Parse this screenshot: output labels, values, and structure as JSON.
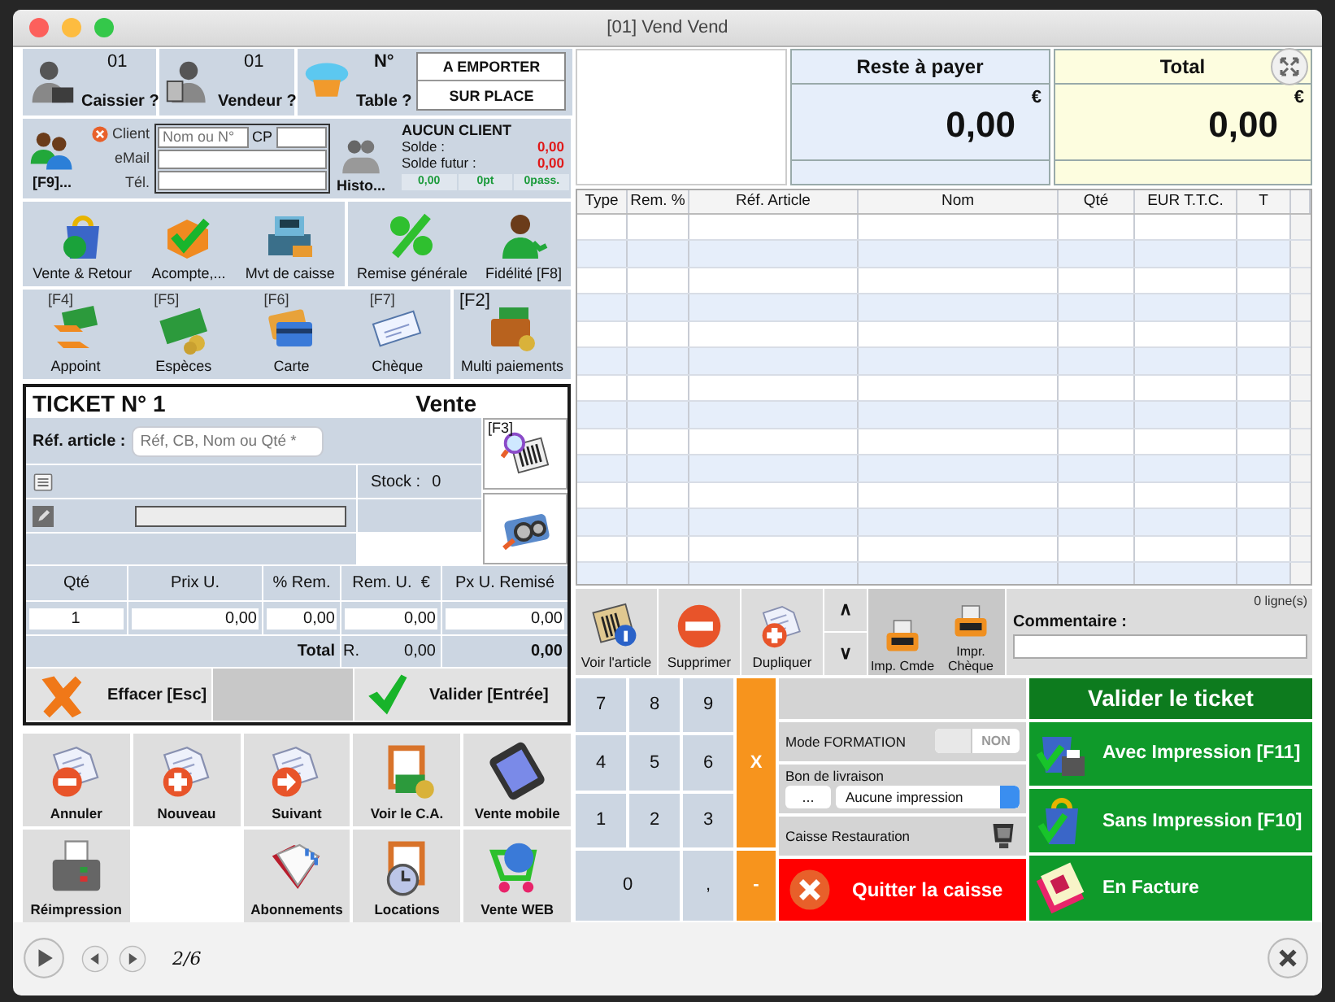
{
  "window": {
    "title": "[01] Vend Vend"
  },
  "header": {
    "cashier": {
      "number": "01",
      "label": "Caissier ?"
    },
    "seller": {
      "number": "01",
      "label": "Vendeur ?"
    },
    "table": {
      "number": "N°",
      "label": "Table ?"
    },
    "service_modes": [
      {
        "label": "A EMPORTER"
      },
      {
        "label": "SUR PLACE"
      }
    ]
  },
  "client": {
    "shortcut": "[F9]...",
    "labels": [
      "Client",
      "eMail",
      "Tél."
    ],
    "name_placeholder": "Nom ou N°",
    "cp_label": "CP",
    "history": "Histo...",
    "status": "AUCUN CLIENT",
    "balances": [
      {
        "label": "Solde :",
        "value": "0,00"
      },
      {
        "label": "Solde futur :",
        "value": "0,00"
      }
    ],
    "counters": [
      "0,00",
      "0pt",
      "0pass."
    ]
  },
  "actions": [
    {
      "label": "Vente & Retour"
    },
    {
      "label": "Acompte,..."
    },
    {
      "label": "Mvt de caisse"
    }
  ],
  "actions_right": [
    {
      "label": "Remise générale"
    },
    {
      "label": "Fidélité [F8]"
    }
  ],
  "payments": [
    {
      "key": "[F4]",
      "label": "Appoint"
    },
    {
      "key": "[F5]",
      "label": "Espèces"
    },
    {
      "key": "[F6]",
      "label": "Carte"
    },
    {
      "key": "[F7]",
      "label": "Chèque"
    }
  ],
  "multi_payment": {
    "key": "[F2]",
    "label": "Multi paiements"
  },
  "ticket": {
    "title": "TICKET N° 1",
    "mode": "Vente",
    "ref_label": "Réf. article :",
    "ref_placeholder": "Réf, CB, Nom ou Qté *",
    "search_key": "[F3]",
    "stock_label": "Stock :",
    "stock": "0",
    "columns": [
      "Qté",
      "Prix U.",
      "% Rem.",
      "Rem. U.  €",
      "Px U. Remisé"
    ],
    "values": [
      "1",
      "0,00",
      "0,00",
      "0,00",
      "0,00"
    ],
    "total_label": "Total",
    "discount_label": "R.",
    "discount_total": "0,00",
    "total": "0,00",
    "clear_button": "Effacer [Esc]",
    "validate_button": "Valider [Entrée]"
  },
  "shortcuts": [
    {
      "kind": "button",
      "label": "Annuler"
    },
    {
      "kind": "button",
      "label": "Nouveau"
    },
    {
      "kind": "button",
      "label": "Suivant"
    },
    {
      "kind": "button",
      "label": "Voir le C.A."
    },
    {
      "kind": "button",
      "label": "Vente mobile"
    },
    {
      "kind": "button",
      "label": "Réimpression"
    },
    {
      "kind": "blank"
    },
    {
      "kind": "button",
      "label": "Abonnements"
    },
    {
      "kind": "button",
      "label": "Locations"
    },
    {
      "kind": "button",
      "label": "Vente WEB"
    }
  ],
  "totals": [
    {
      "label": "Reste à payer",
      "currency": "€",
      "amount": "0,00",
      "color": "#e6eefa"
    },
    {
      "label": "Total",
      "currency": "€",
      "amount": "0,00",
      "color": "#fdfddf"
    }
  ],
  "lines_table": {
    "columns": [
      "Type",
      "Rem. %",
      "Réf. Article",
      "Nom",
      "Qté",
      "EUR T.T.C.",
      "T"
    ]
  },
  "line_tools": [
    {
      "label": "Voir l'article"
    },
    {
      "label": "Supprimer"
    },
    {
      "label": "Dupliquer"
    }
  ],
  "nav": [
    "∧",
    "∨"
  ],
  "print_tools": [
    {
      "label": "Imp. Cmde"
    },
    {
      "label": "Impr. Chèque"
    }
  ],
  "comment": {
    "count": "0 ligne(s)",
    "label": "Commentaire :"
  },
  "keypad": {
    "keys": [
      "7",
      "8",
      "9",
      "4",
      "5",
      "6",
      "1",
      "2",
      "3",
      "0",
      ","
    ],
    "ops": [
      "X",
      "-"
    ]
  },
  "options": {
    "formation": {
      "label": "Mode FORMATION",
      "on": false,
      "state_text": "NON"
    },
    "delivery": {
      "label": "Bon de livraison",
      "more": "...",
      "select": "Aucune impression"
    },
    "restaurant": {
      "label": "Caisse Restauration"
    }
  },
  "quit": {
    "label": "Quitter la caisse"
  },
  "validate": {
    "title": "Valider le ticket",
    "options": [
      {
        "label": "Avec Impression [F11]"
      },
      {
        "label": "Sans Impression [F10]"
      },
      {
        "label": "En Facture"
      }
    ]
  },
  "viewer": {
    "page": "2/6"
  }
}
